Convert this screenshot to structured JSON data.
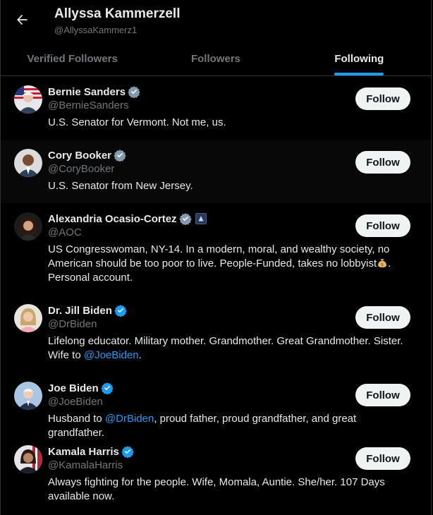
{
  "header": {
    "title": "Allyssa Kammerzell",
    "handle": "@AllyssaKammerz1"
  },
  "tabs": [
    {
      "label": "Verified Followers",
      "active": false
    },
    {
      "label": "Followers",
      "active": false
    },
    {
      "label": "Following",
      "active": true
    }
  ],
  "colors": {
    "accent": "#1d9bf0",
    "verified_blue": "#1d9bf0",
    "verified_gray": "#829aab"
  },
  "users": [
    {
      "name": "Bernie Sanders",
      "handle": "@BernieSanders",
      "badge": "gray-check-icon",
      "bio_pre": "U.S. Senator for Vermont. Not me, us.",
      "follow_label": "Follow"
    },
    {
      "name": "Cory Booker",
      "handle": "@CoryBooker",
      "badge": "gray-check-icon",
      "bio_pre": "U.S. Senator from New Jersey.",
      "follow_label": "Follow"
    },
    {
      "name": "Alexandria Ocasio-Cortez",
      "handle": "@AOC",
      "badge": "gray-check-icon",
      "bio_pre": "US Congresswoman, NY-14. In a modern, moral, and wealthy society, no American should be too poor to live. People-Funded, takes no lobbyist",
      "bio_post": ". Personal account.",
      "follow_label": "Follow"
    },
    {
      "name": "Dr. Jill Biden",
      "handle": "@DrBiden",
      "badge": "blue-check-icon",
      "bio_pre": "Lifelong educator. Military mother. Grandmother. Great Grandmother. Sister. Wife to ",
      "bio_link": "@JoeBiden",
      "bio_post": ".",
      "follow_label": "Follow"
    },
    {
      "name": "Joe Biden",
      "handle": "@JoeBiden",
      "badge": "blue-check-icon",
      "bio_pre": "Husband to ",
      "bio_link": "@DrBiden",
      "bio_post": ", proud father, proud grandfather, and great grandfather.",
      "follow_label": "Follow"
    },
    {
      "name": "Kamala Harris",
      "handle": "@KamalaHarris",
      "badge": "blue-check-icon",
      "bio_pre": "Always fighting for the people. Wife, Momala, Auntie. She/her. 107 Days available now.",
      "follow_label": "Follow"
    }
  ]
}
